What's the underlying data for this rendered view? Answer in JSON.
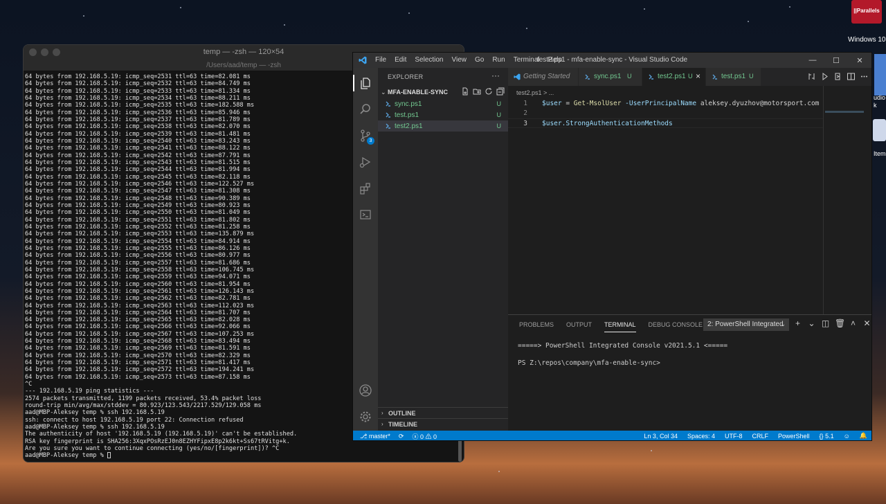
{
  "desktop": {
    "parallels_label": "||Parallels",
    "windows10_label": "Windows 10",
    "edge_text_1": "udio",
    "edge_text_2": "k",
    "edge_text_3": "Item"
  },
  "terminal": {
    "title": "temp — -zsh — 120×54",
    "subtitle": "/Users/aad/temp — -zsh",
    "lines": [
      "64 bytes from 192.168.5.19: icmp_seq=2531 ttl=63 time=82.081 ms",
      "64 bytes from 192.168.5.19: icmp_seq=2532 ttl=63 time=84.749 ms",
      "64 bytes from 192.168.5.19: icmp_seq=2533 ttl=63 time=81.334 ms",
      "64 bytes from 192.168.5.19: icmp_seq=2534 ttl=63 time=88.211 ms",
      "64 bytes from 192.168.5.19: icmp_seq=2535 ttl=63 time=182.588 ms",
      "64 bytes from 192.168.5.19: icmp_seq=2536 ttl=63 time=85.946 ms",
      "64 bytes from 192.168.5.19: icmp_seq=2537 ttl=63 time=81.789 ms",
      "64 bytes from 192.168.5.19: icmp_seq=2538 ttl=63 time=82.070 ms",
      "64 bytes from 192.168.5.19: icmp_seq=2539 ttl=63 time=81.481 ms",
      "64 bytes from 192.168.5.19: icmp_seq=2540 ttl=63 time=83.243 ms",
      "64 bytes from 192.168.5.19: icmp_seq=2541 ttl=63 time=88.122 ms",
      "64 bytes from 192.168.5.19: icmp_seq=2542 ttl=63 time=87.791 ms",
      "64 bytes from 192.168.5.19: icmp_seq=2543 ttl=63 time=81.515 ms",
      "64 bytes from 192.168.5.19: icmp_seq=2544 ttl=63 time=81.994 ms",
      "64 bytes from 192.168.5.19: icmp_seq=2545 ttl=63 time=82.118 ms",
      "64 bytes from 192.168.5.19: icmp_seq=2546 ttl=63 time=122.527 ms",
      "64 bytes from 192.168.5.19: icmp_seq=2547 ttl=63 time=81.308 ms",
      "64 bytes from 192.168.5.19: icmp_seq=2548 ttl=63 time=90.389 ms",
      "64 bytes from 192.168.5.19: icmp_seq=2549 ttl=63 time=80.923 ms",
      "64 bytes from 192.168.5.19: icmp_seq=2550 ttl=63 time=81.049 ms",
      "64 bytes from 192.168.5.19: icmp_seq=2551 ttl=63 time=81.802 ms",
      "64 bytes from 192.168.5.19: icmp_seq=2552 ttl=63 time=81.258 ms",
      "64 bytes from 192.168.5.19: icmp_seq=2553 ttl=63 time=135.879 ms",
      "64 bytes from 192.168.5.19: icmp_seq=2554 ttl=63 time=84.914 ms",
      "64 bytes from 192.168.5.19: icmp_seq=2555 ttl=63 time=86.126 ms",
      "64 bytes from 192.168.5.19: icmp_seq=2556 ttl=63 time=80.977 ms",
      "64 bytes from 192.168.5.19: icmp_seq=2557 ttl=63 time=81.686 ms",
      "64 bytes from 192.168.5.19: icmp_seq=2558 ttl=63 time=106.745 ms",
      "64 bytes from 192.168.5.19: icmp_seq=2559 ttl=63 time=94.071 ms",
      "64 bytes from 192.168.5.19: icmp_seq=2560 ttl=63 time=81.954 ms",
      "64 bytes from 192.168.5.19: icmp_seq=2561 ttl=63 time=126.143 ms",
      "64 bytes from 192.168.5.19: icmp_seq=2562 ttl=63 time=82.781 ms",
      "64 bytes from 192.168.5.19: icmp_seq=2563 ttl=63 time=112.023 ms",
      "64 bytes from 192.168.5.19: icmp_seq=2564 ttl=63 time=81.707 ms",
      "64 bytes from 192.168.5.19: icmp_seq=2565 ttl=63 time=82.028 ms",
      "64 bytes from 192.168.5.19: icmp_seq=2566 ttl=63 time=92.066 ms",
      "64 bytes from 192.168.5.19: icmp_seq=2567 ttl=63 time=107.253 ms",
      "64 bytes from 192.168.5.19: icmp_seq=2568 ttl=63 time=83.494 ms",
      "64 bytes from 192.168.5.19: icmp_seq=2569 ttl=63 time=81.591 ms",
      "64 bytes from 192.168.5.19: icmp_seq=2570 ttl=63 time=82.329 ms",
      "64 bytes from 192.168.5.19: icmp_seq=2571 ttl=63 time=81.417 ms",
      "64 bytes from 192.168.5.19: icmp_seq=2572 ttl=63 time=194.241 ms",
      "64 bytes from 192.168.5.19: icmp_seq=2573 ttl=63 time=87.158 ms",
      "^C",
      "--- 192.168.5.19 ping statistics ---",
      "2574 packets transmitted, 1199 packets received, 53.4% packet loss",
      "round-trip min/avg/max/stddev = 80.923/123.543/2217.529/129.058 ms",
      "aad@MBP-Aleksey temp % ssh 192.168.5.19",
      "ssh: connect to host 192.168.5.19 port 22: Connection refused",
      "aad@MBP-Aleksey temp % ssh 192.168.5.19",
      "The authenticity of host '192.168.5.19 (192.168.5.19)' can't be established.",
      "RSA key fingerprint is SHA256:3XqxPOsRzEJ0n8EZHYFipxE8p2k6kt+Ss67tRVitg+k.",
      "Are you sure you want to continue connecting (yes/no/[fingerprint])? ^C",
      "aad@MBP-Aleksey temp % "
    ]
  },
  "vscode": {
    "menu": [
      "File",
      "Edit",
      "Selection",
      "View",
      "Go",
      "Run",
      "Terminal",
      "Help"
    ],
    "window_title": "test2.ps1 - mfa-enable-sync - Visual Studio Code",
    "window_buttons": [
      "—",
      "☐",
      "✕"
    ],
    "scm_badge": "3",
    "explorer_title": "EXPLORER",
    "explorer_more": "···",
    "folder_name": "MFA-ENABLE-SYNC",
    "files": [
      {
        "name": "sync.ps1",
        "status": "U"
      },
      {
        "name": "test.ps1",
        "status": "U"
      },
      {
        "name": "test2.ps1",
        "status": "U"
      }
    ],
    "outline_label": "OUTLINE",
    "timeline_label": "TIMELINE",
    "tabs": [
      {
        "label": "Getting Started",
        "status": ""
      },
      {
        "label": "sync.ps1",
        "status": "U"
      },
      {
        "label": "test2.ps1",
        "status": "U"
      },
      {
        "label": "test.ps1",
        "status": "U"
      }
    ],
    "breadcrumb": "test2.ps1 > ...",
    "code": {
      "line1": {
        "num": "1",
        "var": "$user",
        "op": " = ",
        "cmd": "Get-MsolUser",
        "param": " -UserPrincipalName",
        "arg": " aleksey.dyuzhov@motorsport.com"
      },
      "line2": {
        "num": "2"
      },
      "line3": {
        "num": "3",
        "text": "$user.StrongAuthenticationMethods"
      }
    },
    "panel_tabs": [
      "PROBLEMS",
      "OUTPUT",
      "TERMINAL",
      "DEBUG CONSOLE"
    ],
    "terminal_select": "2: PowerShell Integrated",
    "terminal_output_1": "=====> PowerShell Integrated Console v2021.5.1 <=====",
    "terminal_output_2": "PS Z:\\repos\\company\\mfa-enable-sync>",
    "status": {
      "branch": "master*",
      "errors": "0",
      "warnings": "0",
      "position": "Ln 3, Col 34",
      "spaces": "Spaces: 4",
      "encoding": "UTF-8",
      "eol": "CRLF",
      "language": "PowerShell",
      "version": "5.1"
    },
    "colors": {
      "accent": "#007acc",
      "untracked": "#73c991"
    }
  }
}
